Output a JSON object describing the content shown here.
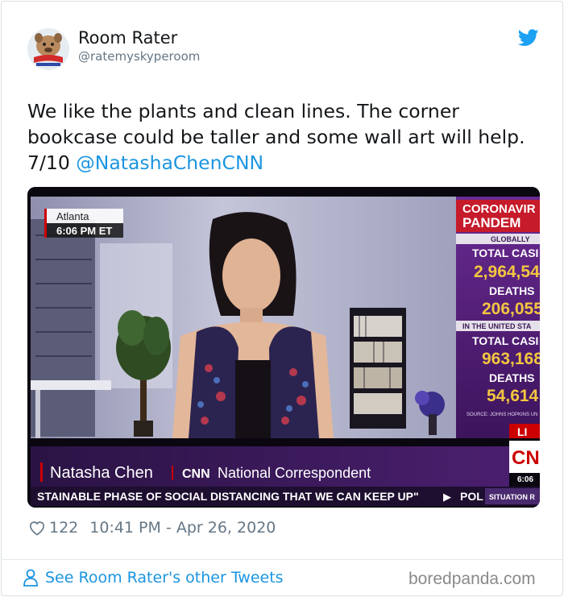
{
  "author": {
    "name": "Room Rater",
    "handle": "@ratemyskyperoom",
    "avatar_icon": "dog-mascot-avatar"
  },
  "tweet": {
    "text": "We like the plants and clean lines. The corner bookcase could be taller and some wall art will help. 7/10 ",
    "mention": "@NatashaChenCNN",
    "likes": "122",
    "timestamp": "10:41 PM - Apr 26, 2020"
  },
  "media": {
    "location": "Atlanta",
    "time": "6:06 PM ET",
    "person_name": "Natasha Chen",
    "network": "CNN",
    "role": "National Correspondent",
    "ticker": "STAINABLE PHASE OF SOCIAL DISTANCING THAT WE CAN KEEP UP\"",
    "ticker_next": "POL",
    "situation": "SITUATION R",
    "live_badge": "LI",
    "live_time": "6:06",
    "panel": {
      "headline_1": "CORONAVIR",
      "headline_2": "PANDEM",
      "globally": "GLOBALLY",
      "total_cases_label": "TOTAL CASI",
      "global_cases": "2,964,54",
      "deaths_label": "DEATHS",
      "global_deaths": "206,055",
      "us_label": "IN THE UNITED STA",
      "us_cases": "963,168",
      "us_deaths": "54,614",
      "source": "SOURCE: JOHNS HOPKINS UN"
    }
  },
  "footer": {
    "other_tweets": "See Room Rater's other Tweets",
    "watermark": "boredpanda.com"
  },
  "colors": {
    "link": "#1b95e0",
    "cnn_red": "#cc0000",
    "panel_purple": "#5a2080"
  }
}
